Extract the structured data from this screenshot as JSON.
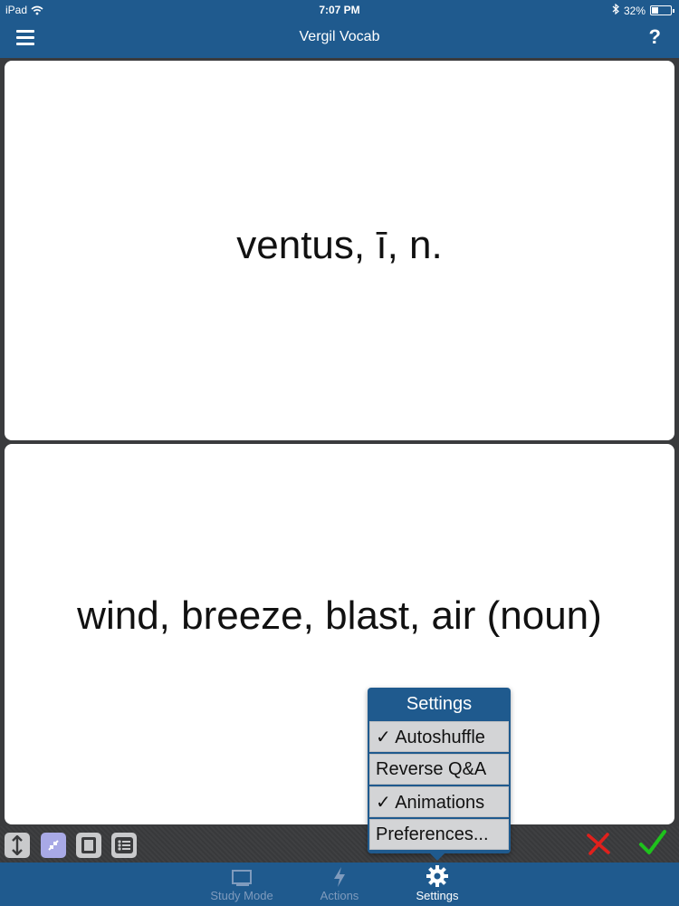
{
  "status_bar": {
    "device": "iPad",
    "time": "7:07 PM",
    "battery": "32%"
  },
  "header": {
    "title": "Vergil Vocab",
    "help_label": "?"
  },
  "card": {
    "front_text": "ventus, ī, n.",
    "back_text": "wind, breeze, blast, air (noun)"
  },
  "settings_popover": {
    "title": "Settings",
    "items": [
      {
        "label": "✓ Autoshuffle"
      },
      {
        "label": "Reverse Q&A"
      },
      {
        "label": "✓ Animations"
      },
      {
        "label": "Preferences..."
      }
    ]
  },
  "toolbar": {
    "icons": [
      "resize-vertical-icon",
      "collapse-icon",
      "single-card-icon",
      "list-icon"
    ],
    "marks": {
      "wrong": "red-x-icon",
      "right": "green-check-icon"
    }
  },
  "tabs": [
    {
      "label": "Study Mode",
      "icon": "study-mode-icon"
    },
    {
      "label": "Actions",
      "icon": "lightning-icon"
    },
    {
      "label": "Settings",
      "icon": "gear-icon"
    }
  ],
  "colors": {
    "bar_blue": "#1f5a8e",
    "tab_inactive": "#7f9bbd",
    "wrong_red": "#e0201c",
    "right_green": "#1ec21c"
  }
}
